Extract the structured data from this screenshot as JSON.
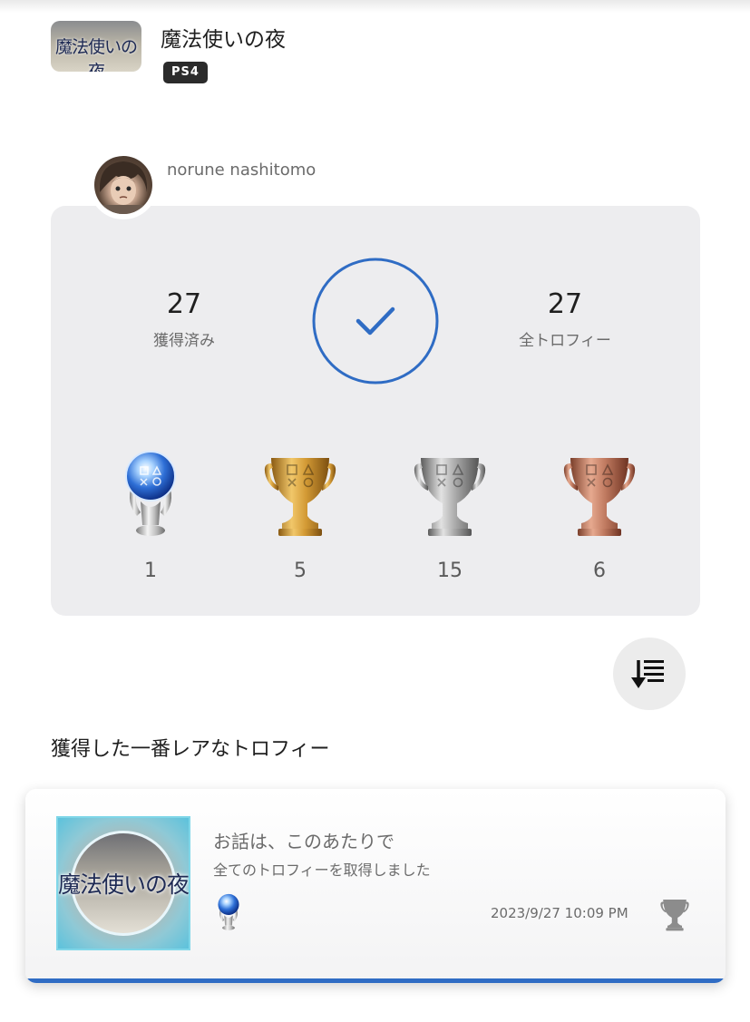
{
  "game": {
    "title": "魔法使いの夜",
    "platform": "PS4",
    "thumbnail_text": "魔法使いの夜"
  },
  "user": {
    "name": "norune nashitomo"
  },
  "progress": {
    "earned_count": "27",
    "earned_label": "獲得済み",
    "total_count": "27",
    "total_label": "全トロフィー",
    "percent": 100,
    "status_icon": "check-icon",
    "accent_color": "#2f6cc4"
  },
  "trophies": [
    {
      "type": "platinum",
      "count": "1"
    },
    {
      "type": "gold",
      "count": "5"
    },
    {
      "type": "silver",
      "count": "15"
    },
    {
      "type": "bronze",
      "count": "6"
    }
  ],
  "sort_button": {
    "icon": "sort-descending-icon"
  },
  "rarest": {
    "section_title": "獲得した一番レアなトロフィー",
    "name": "お話は、このあたりで",
    "description": "全てのトロフィーを取得しました",
    "trophy_type": "platinum",
    "date": "2023/9/27  10:09 PM",
    "icon_text": "魔法使いの夜",
    "accent_color": "#2f6cc4"
  }
}
